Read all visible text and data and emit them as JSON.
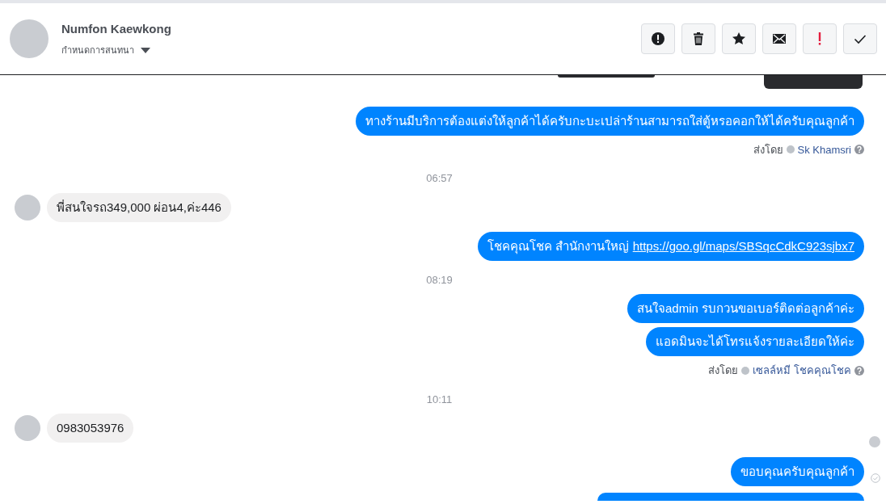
{
  "header": {
    "name": "Numfon Kaewkong",
    "subtitle": "กำหนดการสนทนา"
  },
  "messages": [
    {
      "kind": "images"
    },
    {
      "kind": "outgoing",
      "text": "ทางร้านมีบริการต้องแต่งให้ลูกค้าได้ครับกะบะเปล่าร้านสามารถใส่ตู้หรอคอกให้ได้ครับคุณลูกค้า"
    },
    {
      "kind": "sent_by",
      "label": "ส่งโดย",
      "sender": "Sk Khamsri"
    },
    {
      "kind": "time",
      "text": "06:57"
    },
    {
      "kind": "incoming",
      "text": "พี่สนใจรถ349,000 ผ่อน4,ค่ะ446"
    },
    {
      "kind": "outgoing",
      "text": "โชคคุณโชค สำนักงานใหญ่",
      "link": "https://goo.gl/maps/SBSqcCdkC923sjbx7"
    },
    {
      "kind": "time",
      "text": "08:19"
    },
    {
      "kind": "outgoing",
      "text": "สนใจadmin รบกวนขอเบอร์ติดต่อลูกค้าค่ะ"
    },
    {
      "kind": "outgoing",
      "text": "แอดมินจะได้โทรแจ้งรายละเอียดให้ค่ะ"
    },
    {
      "kind": "sent_by",
      "label": "ส่งโดย",
      "sender": "เซลล์หมี โชคคุณโชค"
    },
    {
      "kind": "time",
      "text": "10:11"
    },
    {
      "kind": "incoming",
      "text": "0983053976"
    },
    {
      "kind": "seen"
    },
    {
      "kind": "outgoing",
      "text": "ขอบคุณครับคุณลูกค้า",
      "delivered": true
    },
    {
      "kind": "partial"
    }
  ]
}
